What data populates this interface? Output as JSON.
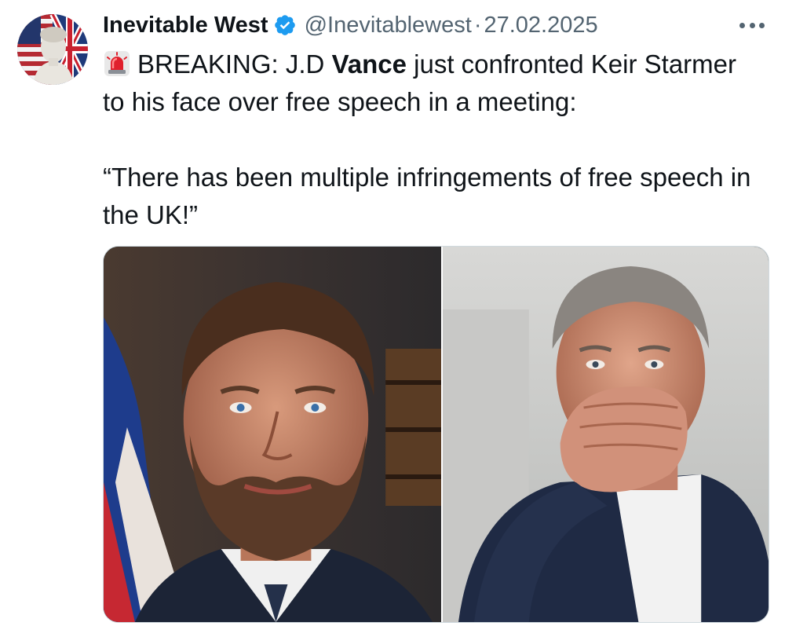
{
  "tweet": {
    "author": {
      "display_name": "Inevitable West",
      "handle": "@Inevitablewest",
      "verified": true,
      "avatar_icon": "statue-flags-avatar"
    },
    "separator": "·",
    "date": "27.02.2025",
    "more_icon": "more-horizontal-icon",
    "text": {
      "emoji_icon": "siren-emoji",
      "line1_prefix": "BREAKING: J.D ",
      "line1_bold": "Vance",
      "line1_suffix": " just confronted Keir Starmer to his face over free speech in a meeting:",
      "quote": "“There has been multiple infringements of free speech in the UK!”"
    },
    "media": [
      {
        "name": "photo-jd-vance",
        "icon": "portrait-photo"
      },
      {
        "name": "photo-keir-starmer",
        "icon": "portrait-photo"
      }
    ]
  },
  "colors": {
    "text": "#0f1419",
    "secondary": "#536471",
    "verified": "#1d9bf0",
    "border": "#cfd9de"
  }
}
